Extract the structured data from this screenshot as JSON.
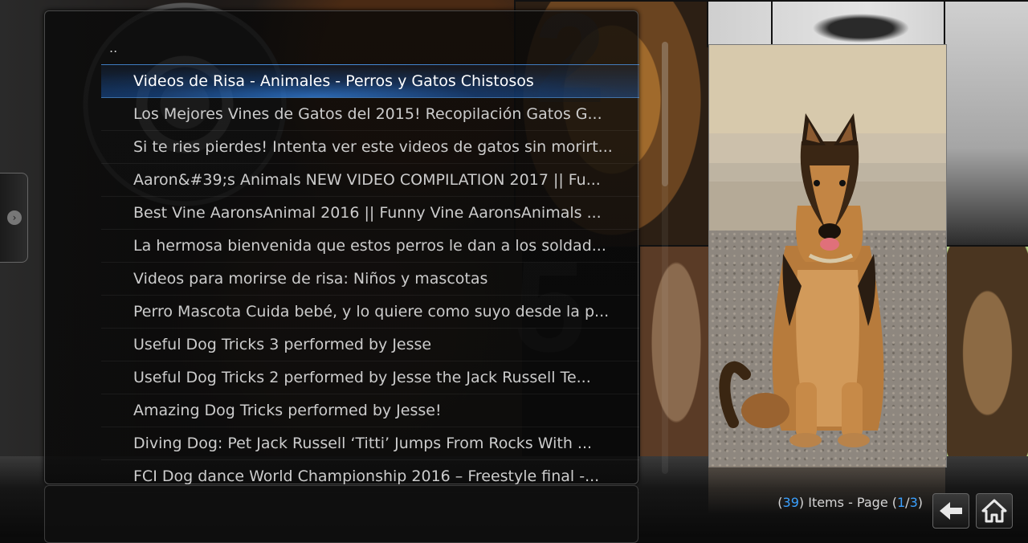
{
  "list": {
    "parent_label": "..",
    "items": [
      "Videos de Risa - Animales - Perros y Gatos Chistosos",
      "Los Mejores Vines de Gatos del 2015! Recopilación Gatos G...",
      "Si te ries pierdes! Intenta ver este videos de gatos sin morirt...",
      "Aaron&#39;s Animals NEW VIDEO COMPILATION 2017 || Fu...",
      "Best Vine AaronsAnimal 2016 || Funny Vine AaronsAnimals ...",
      "La hermosa bienvenida que estos perros le dan a los soldad...",
      "Videos para morirse de risa: Niños y mascotas",
      "Perro Mascota Cuida bebé, y lo quiere como suyo desde la p...",
      "Useful Dog Tricks 3 performed by Jesse",
      "Useful Dog Tricks 2 performed by Jesse the Jack Russell Te...",
      "Amazing Dog Tricks performed by Jesse!",
      "Diving Dog: Pet Jack Russell ‘Titti’ Jumps From Rocks With ...",
      "FCI Dog dance World Championship 2016 – Freestyle final  -..."
    ],
    "focused_index": 0
  },
  "footer": {
    "open_paren": "(",
    "item_count": "39",
    "items_text": ") Items - Page (",
    "current_page": "1",
    "slash": "/",
    "total_pages": "3",
    "close_paren": ")"
  },
  "background": {
    "numbers": [
      "2",
      "5"
    ]
  },
  "colors": {
    "accent": "#3aa0ff",
    "focus_glow": "#1e6edc"
  },
  "icons": {
    "back": "back-arrow-icon",
    "home": "home-icon",
    "side_tab": "chevron-right-icon"
  }
}
